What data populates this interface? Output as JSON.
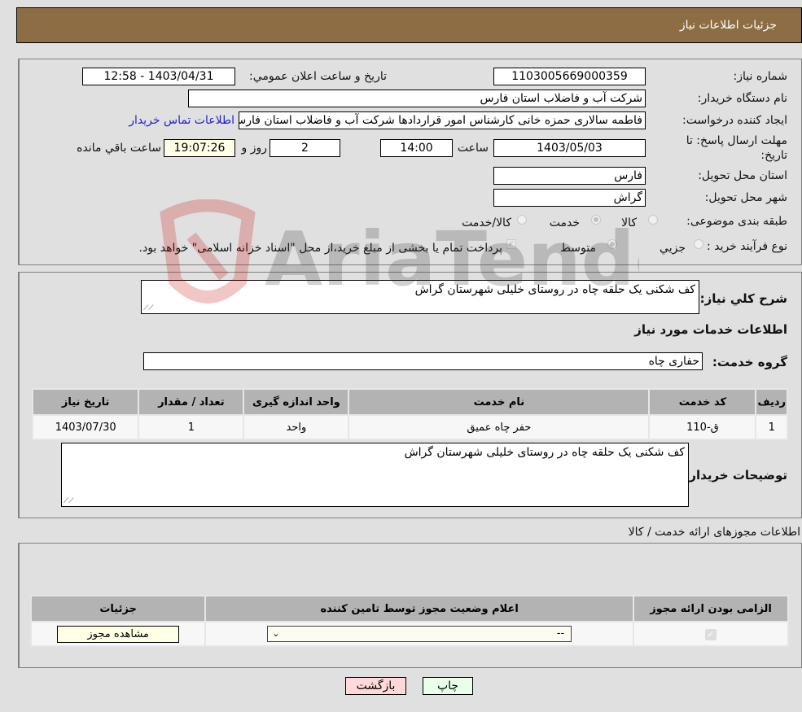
{
  "header": {
    "title": "جزئیات اطلاعات نیاز"
  },
  "form": {
    "need_number": {
      "label": "شماره نیاز:",
      "value": "1103005669000359"
    },
    "announce_datetime": {
      "label": "تاریخ و ساعت اعلان عمومي:",
      "value": "1403/04/31 - 12:58"
    },
    "buyer_org": {
      "label": "نام دستگاه خريدار:",
      "value": "شرکت آب و فاضلاب استان فارس"
    },
    "requester": {
      "label": "ايجاد کننده درخواست:",
      "value": "فاطمه سالاری حمزه خانی کارشناس امور قراردادها شرکت آب و فاضلاب استان فارس"
    },
    "buyer_contact_link": "اطلاعات تماس خريدار",
    "deadline": {
      "label": "مهلت ارسال پاسخ: تا تاریخ:",
      "date": "1403/05/03",
      "time_label": "ساعت",
      "time": "14:00",
      "days": "2",
      "days_label": "روز و",
      "remaining": "19:07:26",
      "remaining_label": "ساعت باقي مانده"
    },
    "delivery_province": {
      "label": "استان محل تحويل:",
      "value": "فارس"
    },
    "delivery_city": {
      "label": "شهر محل تحويل:",
      "value": "گراش"
    },
    "category": {
      "label": "طبقه بندی موضوعی:",
      "options": [
        "کالا",
        "خدمت",
        "کالا/خدمت"
      ],
      "selected": "خدمت"
    },
    "purchase_type": {
      "label": "نوع فرآيند خريد :",
      "options": [
        "جزيي",
        "متوسط"
      ],
      "selected": "متوسط",
      "treasury_note": "پرداخت تمام یا بخشی از مبلغ خرید،از محل \"اسناد خزانه اسلامی\" خواهد بود.",
      "treasury_checked": true
    }
  },
  "description": {
    "label": "شرح کلي نياز:",
    "value": "کف شکنی یک حلقه چاه در روستای خلیلی شهرستان گراش"
  },
  "services": {
    "section_title": "اطلاعات خدمات مورد نياز",
    "group_label": "گروه خدمت:",
    "group_value": "حفاری چاه",
    "columns": [
      "رديف",
      "کد خدمت",
      "نام خدمت",
      "واحد اندازه گيری",
      "تعداد / مقدار",
      "تاريخ نياز"
    ],
    "rows": [
      {
        "index": "1",
        "code": "ق-110",
        "name": "حفر چاه عمیق",
        "unit": "واحد",
        "qty": "1",
        "date": "1403/07/30"
      }
    ]
  },
  "buyer_notes": {
    "label": "توضيحات خريدار:",
    "value": "کف شکنی یک حلقه چاه در روستای خلیلی شهرستان گراش"
  },
  "licenses": {
    "section_title": "اطلاعات مجوزهای ارائه خدمت / کالا",
    "columns": [
      "الزامی بودن ارائه مجوز",
      "اعلام وضعیت مجوز توسط تامین کننده",
      "جزئیات"
    ],
    "row": {
      "required": true,
      "status": "--",
      "details_button": "مشاهده مجوز"
    }
  },
  "buttons": {
    "print": "چاپ",
    "back": "بازگشت"
  },
  "watermark": "AriaTender.neT",
  "colors": {
    "header_bg": "#8c6d44",
    "print_bg": "#eaffea",
    "back_bg": "#ffd9d9",
    "remaining_bg": "#ffffe6"
  }
}
